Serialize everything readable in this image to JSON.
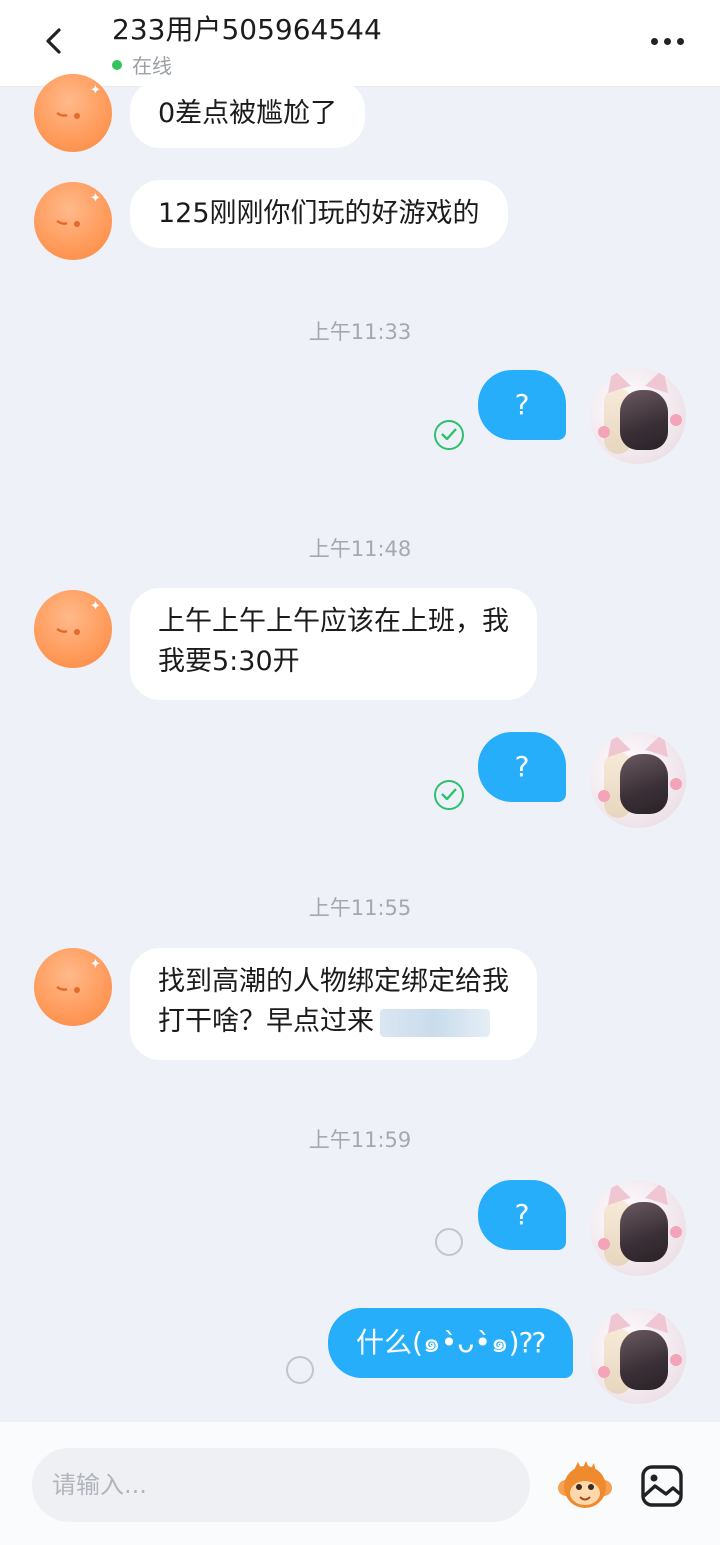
{
  "header": {
    "title": "233用户505964544",
    "status": "在线",
    "status_color": "#33c45a"
  },
  "icons": {
    "back": "back-arrow-icon",
    "more": "more-dots-icon",
    "sticker": "monkey-sticker-icon",
    "image": "image-gallery-icon",
    "delivered": "check-circle-icon",
    "pending": "pending-circle-icon"
  },
  "messages": [
    {
      "type": "in",
      "text": "0差点被尴尬了"
    },
    {
      "type": "in",
      "text": "125刚刚你们玩的好游戏的"
    },
    {
      "type": "time",
      "text": "上午11:33"
    },
    {
      "type": "out",
      "text": "?",
      "status": "delivered"
    },
    {
      "type": "time",
      "text": "上午11:48"
    },
    {
      "type": "in",
      "lines": [
        "上午上午上午应该在上班，我",
        "我要5:30开"
      ]
    },
    {
      "type": "out",
      "text": "?",
      "status": "delivered"
    },
    {
      "type": "time",
      "text": "上午11:55"
    },
    {
      "type": "in",
      "lines": [
        "找到高潮的人物绑定绑定给我",
        "打干啥？早点过来"
      ]
    },
    {
      "type": "time",
      "text": "上午11:59"
    },
    {
      "type": "out",
      "text": "?",
      "status": "pending"
    },
    {
      "type": "out",
      "text": "什么(๑•̀ᴗ•̀๑)⁇",
      "status": "pending"
    }
  ],
  "input": {
    "placeholder": "请输入..."
  },
  "colors": {
    "accent": "#27aefb",
    "background": "#eef1f7"
  }
}
